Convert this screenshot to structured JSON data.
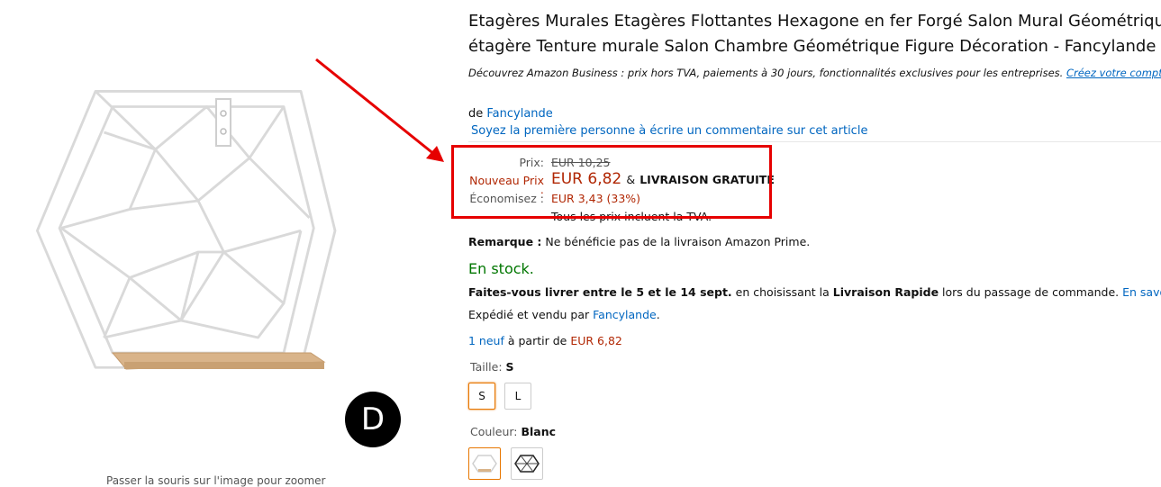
{
  "product": {
    "title_line1": "Etagères Murales Etagères Flottantes Hexagone en fer Forgé Salon Mural Géométrique Fe",
    "title_line2": "étagère Tenture murale Salon Chambre Géométrique Figure Décoration - Fancylande",
    "business_text": "Découvrez Amazon Business : prix hors TVA, paiements à 30 jours, fonctionnalités exclusives pour les entreprises.",
    "business_link": "Créez votre compte gratuit",
    "business_end": ".",
    "by_prefix": "de",
    "brand": "Fancylande",
    "review_link": "Soyez la première personne à écrire un commentaire sur cet article"
  },
  "price": {
    "old_label": "Prix:",
    "old_value": "EUR 10,25",
    "new_label": "Nouveau Prix :",
    "new_value": "EUR 6,82",
    "amp": "&",
    "free_shipping": "LIVRAISON GRATUITE",
    "save_label": "Économisez :",
    "save_value": "EUR 3,43 (33%)",
    "vat_note": "Tous les prix incluent la TVA."
  },
  "details": {
    "remark_label": "Remarque :",
    "remark_text": "Ne bénéficie pas de la livraison Amazon Prime.",
    "stock": "En stock.",
    "deliver_bold": "Faites-vous livrer entre le 5 et le 14 sept.",
    "deliver_mid": "en choisissant la",
    "deliver_fast": "Livraison Rapide",
    "deliver_end": "lors du passage de commande.",
    "learn_more": "En savoir plus.",
    "sold_text": "Expédié et vendu par",
    "sold_by": "Fancylande",
    "sold_end": ".",
    "offers_link": "1 neuf",
    "offers_text": "à partir de",
    "offers_price": "EUR 6,82"
  },
  "size": {
    "label": "Taille:",
    "selected": "S",
    "options": [
      "S",
      "L"
    ]
  },
  "color": {
    "label": "Couleur:",
    "selected": "Blanc"
  },
  "image": {
    "hover_hint": "Passer la souris sur l'image pour zoomer",
    "overlay_letter": "D"
  },
  "colors": {
    "link": "#0066c0",
    "price_red": "#b12704",
    "stock_green": "#007600",
    "highlight_red": "#e60000",
    "selected_orange": "#e77600"
  }
}
